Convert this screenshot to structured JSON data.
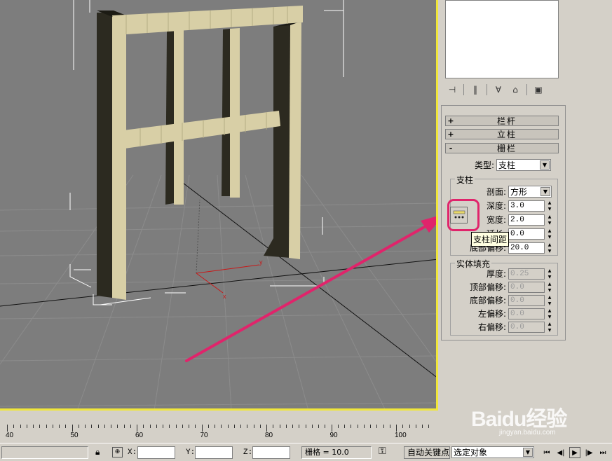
{
  "rollouts": {
    "railings": {
      "sign": "+",
      "title": "栏杆"
    },
    "posts": {
      "sign": "+",
      "title": "立柱"
    },
    "fencing": {
      "sign": "-",
      "title": "栅栏"
    }
  },
  "fencing": {
    "type_label": "类型:",
    "type_value": "支柱",
    "pickets_group": "支柱",
    "profile_label": "剖面:",
    "profile_value": "方形",
    "depth_label": "深度:",
    "depth_value": "3.0",
    "width_label": "宽度:",
    "width_value": "2.0",
    "extension_label": "延长:",
    "extension_value": "0.0",
    "bottom_offset_label": "底部偏移:",
    "bottom_offset_value": "20.0",
    "spacing_tooltip": "支柱间距",
    "solid_group": "实体填充",
    "thickness_label": "厚度:",
    "thickness_value": "0.25",
    "top_offset_label": "顶部偏移:",
    "top_offset_value": "0.0",
    "solid_bottom_offset_label": "底部偏移:",
    "solid_bottom_offset_value": "0.0",
    "left_offset_label": "左偏移:",
    "left_offset_value": "0.0",
    "right_offset_label": "右偏移:",
    "right_offset_value": "0.0"
  },
  "timeline": {
    "labels": [
      "40",
      "50",
      "60",
      "70",
      "80",
      "90",
      "100"
    ]
  },
  "status": {
    "x_label": "X:",
    "y_label": "Y:",
    "z_label": "Z:",
    "grid_text": "栅格 = 10.0",
    "auto_key": "自动关键点",
    "selection_value": "选定对象"
  },
  "viewport": {
    "axis_x": "x",
    "axis_y": "y"
  },
  "watermark": {
    "main": "Baidu经验",
    "sub": "jingyan.baidu.com"
  },
  "colors": {
    "viewport_bg": "#7d7d7d",
    "active_border": "#f0e63a",
    "highlight": "#e0246b",
    "wood_light": "#d8cfa6",
    "wood_dark": "#2c2a20"
  }
}
